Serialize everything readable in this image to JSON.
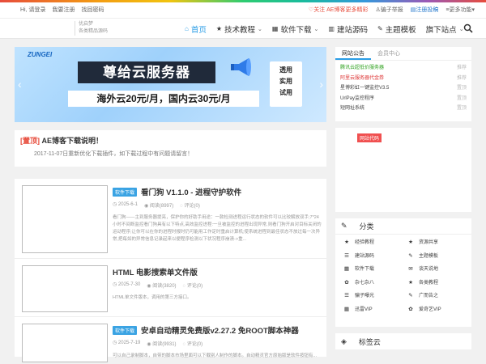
{
  "topbar": {
    "login": "Hi, 请登录",
    "register": "我要注册",
    "recover": "找回密码",
    "follow": "关注 AE博客更多精彩",
    "report": "骗子举报",
    "submit": "注册投稿",
    "more": "更多功能"
  },
  "header": {
    "logo_line1": "优启梦",
    "logo_line2": "各类精品源码"
  },
  "nav": [
    {
      "label": "首页",
      "icon": "home-icon"
    },
    {
      "label": "技术教程",
      "icon": "star-icon"
    },
    {
      "label": "软件下载",
      "icon": "grid-icon"
    },
    {
      "label": "建站源码",
      "icon": "columns-icon"
    },
    {
      "label": "主题模板",
      "icon": "pencil-icon"
    },
    {
      "label": "旗下站点"
    }
  ],
  "banner": {
    "brand": "ZUNGEI",
    "title": "尊给云服务器",
    "subtitle": "海外云20元/月，国内云30元/月",
    "badge_1": "透用",
    "badge_2": "实用",
    "badge_3": "试用"
  },
  "notice": {
    "tag": "[置顶]",
    "title": "AE博客下载说明！",
    "desc": "2017-11-07日重新优化下载插件，如下载过程中有问题请留言！"
  },
  "posts": [
    {
      "category": "软件下载",
      "title": "看门狗 V1.1.0 - 进程守护软件",
      "date": "2025-6-1",
      "views": "阅读(8997)",
      "comments": "评论(0)",
      "desc": "看门狗——主到服务器提亮，保护你的好助手用途：一款检测进程运行状态的软件可以比较解放双手;7*24小时不间断监控看门狗具有以下特点,高效监控进程:一旦被监控的进程出现异常,则看门狗开启对目标关闭的运动程序;让你可以在你的进程时报时仍可能用工作定时重启计算机;使系统进程到最佳状态不放过每一次异常,把每如的异常信息记录起来以便程序检测以下状况程序崩溃->重..."
    },
    {
      "title": "HTML 电影搜索单文件版",
      "date": "2025-7-30",
      "views": "阅读(3820)",
      "comments": "评论(0)",
      "desc": "HTML单文件版本，调用的第三方接口。"
    },
    {
      "category": "软件下载",
      "title": "安卓自动精灵免费版v2.27.2 免ROOT脚本神器",
      "date": "2025-7-19",
      "views": "阅读(9931)",
      "comments": "评论(0)",
      "desc": "可以自己录制脚本，自带的脚本市场里面可以下载别人制作的脚本。自动精灵官方原始版是软件按钮有..."
    }
  ],
  "sidebar": {
    "tabs": [
      "网站公告",
      "会员中心"
    ],
    "announcements": [
      {
        "name": "腾讯云超低价服务器",
        "tag": "推荐",
        "style": "green"
      },
      {
        "name": "阿里云服务器代金券",
        "tag": "推荐",
        "style": "red"
      },
      {
        "name": "星博彩虹一键监控V3.5",
        "tag": "置顶",
        "style": ""
      },
      {
        "name": "UrlPay监控程序",
        "tag": "置顶",
        "style": ""
      },
      {
        "name": "短网址系统",
        "tag": "置顶",
        "style": ""
      }
    ],
    "ad_label": "网站代码",
    "categories_title": "分类",
    "categories": [
      {
        "label": "经验教程",
        "icon": "star-icon",
        "glyph": "★"
      },
      {
        "label": "资源共享",
        "icon": "star-icon",
        "glyph": "★"
      },
      {
        "label": "建站源码",
        "icon": "list-icon",
        "glyph": "☰"
      },
      {
        "label": "主题模板",
        "icon": "pencil-icon",
        "glyph": "✎"
      },
      {
        "label": "软件下载",
        "icon": "grid-icon",
        "glyph": "▦"
      },
      {
        "label": "谈天说地",
        "icon": "chat-icon",
        "glyph": "✉"
      },
      {
        "label": "杂七杂八",
        "icon": "leaf-icon",
        "glyph": "✿"
      },
      {
        "label": "各类教程",
        "icon": "star-icon",
        "glyph": "★"
      },
      {
        "label": "骗子曝光",
        "icon": "list-icon",
        "glyph": "☰"
      },
      {
        "label": "广而告之",
        "icon": "pencil-icon",
        "glyph": "✎"
      },
      {
        "label": "迅雷VIP",
        "icon": "grid-icon",
        "glyph": "▦"
      },
      {
        "label": "爱奇艺VIP",
        "icon": "leaf-icon",
        "glyph": "✿"
      }
    ],
    "tags_title": "标签云"
  }
}
